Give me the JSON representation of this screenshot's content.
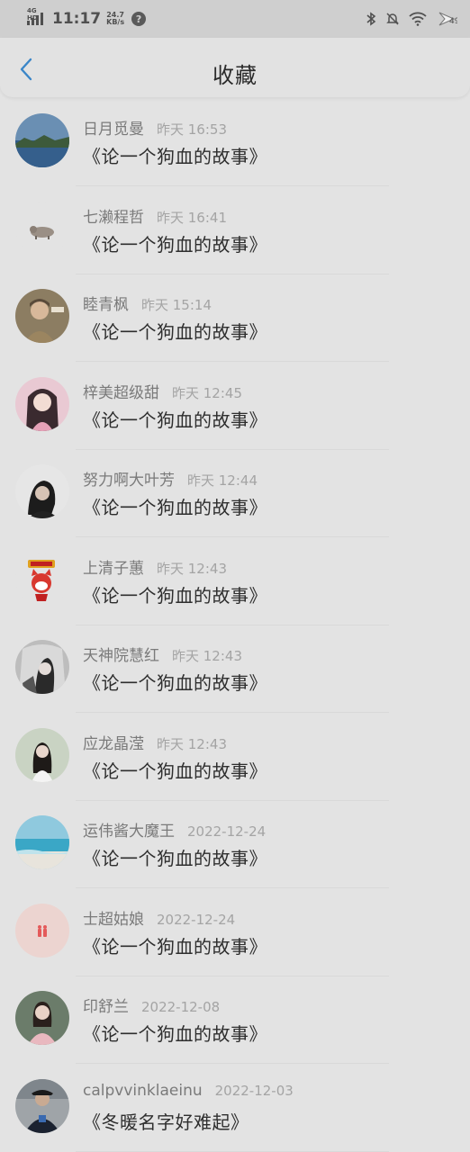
{
  "status_bar": {
    "network": "4G HD",
    "time": "11:17",
    "speed_value": "24.7",
    "speed_unit": "KB/s",
    "help_glyph": "?",
    "icons": [
      "bluetooth-icon",
      "bell-muted-icon",
      "wifi-icon",
      "battery-icon"
    ],
    "battery": "49"
  },
  "header": {
    "back_icon": "chevron-left-icon",
    "title": "收藏"
  },
  "items": [
    {
      "name": "日月觅曼",
      "time": "昨天 16:53",
      "snippet": "《论一个狗血的故事》",
      "avatar": "landscape-lake"
    },
    {
      "name": "七濑程哲",
      "time": "昨天 16:41",
      "snippet": "《论一个狗血的故事》",
      "avatar": "small-animal"
    },
    {
      "name": "睦青枫",
      "time": "昨天 15:14",
      "snippet": "《论一个狗血的故事》",
      "avatar": "person-brown"
    },
    {
      "name": "梓美超级甜",
      "time": "昨天 12:45",
      "snippet": "《论一个狗血的故事》",
      "avatar": "anime-girl-pink"
    },
    {
      "name": "努力啊大叶芳",
      "time": "昨天 12:44",
      "snippet": "《论一个狗血的故事》",
      "avatar": "person-dark-hair"
    },
    {
      "name": "上清子蕙",
      "time": "昨天 12:43",
      "snippet": "《论一个狗血的故事》",
      "avatar": "red-cartoon"
    },
    {
      "name": "天神院慧红",
      "time": "昨天 12:43",
      "snippet": "《论一个狗血的故事》",
      "avatar": "person-bw"
    },
    {
      "name": "应龙晶滢",
      "time": "昨天 12:43",
      "snippet": "《论一个狗血的故事》",
      "avatar": "person-white-dress"
    },
    {
      "name": "运伟酱大魔王",
      "time": "2022-12-24",
      "snippet": "《论一个狗血的故事》",
      "avatar": "sea-sky"
    },
    {
      "name": "士超姑娘",
      "time": "2022-12-24",
      "snippet": "《论一个狗血的故事》",
      "avatar": "pink-figures"
    },
    {
      "name": "印舒兰",
      "time": "2022-12-08",
      "snippet": "《论一个狗血的故事》",
      "avatar": "person-pink-top"
    },
    {
      "name": "calpvvinklaeinu",
      "time": "2022-12-03",
      "snippet": "《冬暖名字好难起》",
      "avatar": "person-dark-jacket"
    }
  ],
  "colors": {
    "accent": "#3a86c8",
    "overlay_bg": "#e3e3e3"
  }
}
